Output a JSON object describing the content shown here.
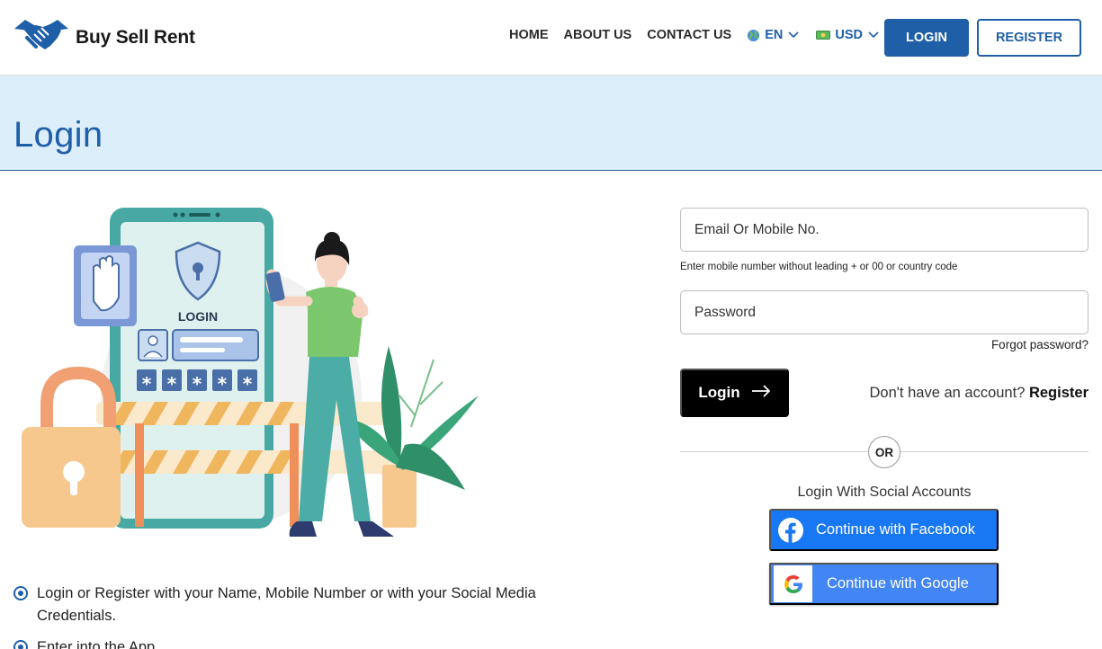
{
  "header": {
    "logo_text": "Buy Sell Rent",
    "nav": [
      {
        "label": "HOME"
      },
      {
        "label": "ABOUT US"
      },
      {
        "label": "CONTACT US"
      }
    ],
    "language": {
      "label": "EN",
      "icon": "globe-icon"
    },
    "currency": {
      "label": "USD",
      "icon": "money-icon"
    },
    "login_label": "LOGIN",
    "register_label": "REGISTER"
  },
  "banner": {
    "title": "Login"
  },
  "illustration": {
    "screen_label": "LOGIN",
    "password_mask": "*****"
  },
  "bullets": [
    "Login or Register with your Name, Mobile Number or with your Social Media Credentials.",
    "Enter into the App"
  ],
  "form": {
    "email_placeholder": "Email Or Mobile No.",
    "email_hint": "Enter mobile number without leading + or 00 or country code",
    "password_placeholder": "Password",
    "forgot_label": "Forgot password?",
    "login_button": "Login",
    "no_account_text": "Don't have an account?",
    "register_link": "Register",
    "or_label": "OR",
    "social_title": "Login With Social Accounts",
    "facebook_label": "Continue with Facebook",
    "google_label": "Continue with Google"
  },
  "colors": {
    "brand_blue": "#1f5fa8",
    "banner_bg": "#ddeefb",
    "facebook": "#1877f2",
    "google": "#4285f4"
  }
}
